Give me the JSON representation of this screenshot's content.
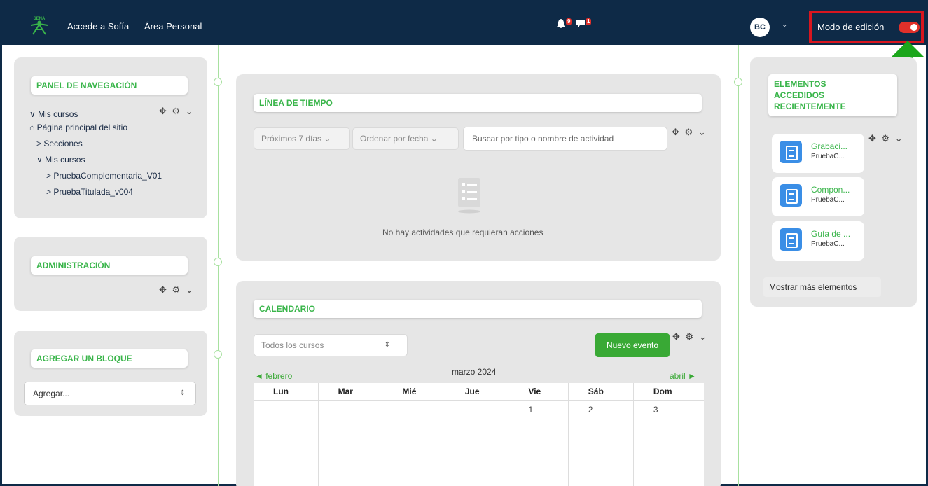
{
  "navbar": {
    "links": [
      "Accede a Sofía",
      "Área Personal"
    ],
    "notification_count": "9",
    "message_count": "1",
    "avatar_initials": "BC",
    "edit_mode_label": "Modo de edición",
    "edit_mode_on": true
  },
  "nav_panel": {
    "title": "PANEL DE NAVEGACIÓN",
    "items": [
      {
        "label": "Mis cursos",
        "prefix": "∨"
      },
      {
        "label": "Página principal del sitio",
        "prefix": "home"
      },
      {
        "label": "Secciones",
        "prefix": ">"
      },
      {
        "label": "Mis cursos",
        "prefix": "∨"
      },
      {
        "label": "PruebaComplementaria_V01",
        "prefix": ">"
      },
      {
        "label": "PruebaTitulada_v004",
        "prefix": ">"
      }
    ]
  },
  "admin_panel": {
    "title": "ADMINISTRACIÓN"
  },
  "add_block": {
    "title": "AGREGAR UN BLOQUE",
    "select_value": "Agregar..."
  },
  "timeline": {
    "title": "LÍNEA DE TIEMPO",
    "filter_range": "Próximos 7 días",
    "sort": "Ordenar por fecha",
    "search_placeholder": "Buscar por tipo o nombre de actividad",
    "empty_message": "No hay actividades que requieran acciones"
  },
  "calendar": {
    "title": "CALENDARIO",
    "course_filter": "Todos los cursos",
    "new_event_label": "Nuevo evento",
    "prev_month": "febrero",
    "current_month": "marzo 2024",
    "next_month": "abril",
    "weekdays": [
      "Lun",
      "Mar",
      "Mié",
      "Jue",
      "Vie",
      "Sáb",
      "Dom"
    ],
    "first_week": [
      "",
      "",
      "",
      "",
      "1",
      "2",
      "3"
    ]
  },
  "recent": {
    "title_lines": [
      "ELEMENTOS",
      "ACCEDIDOS",
      "RECIENTEMENTE"
    ],
    "items": [
      {
        "name": "Grabaci...",
        "course": "PruebaC..."
      },
      {
        "name": "Compon...",
        "course": "PruebaC..."
      },
      {
        "name": "Guía de ...",
        "course": "PruebaC..."
      }
    ],
    "more_label": "Mostrar más elementos"
  },
  "colors": {
    "navbar": "#0e2a47",
    "accent_green": "#39b54a",
    "highlight_red": "#d8161f",
    "toggle_red": "#e0302a"
  }
}
